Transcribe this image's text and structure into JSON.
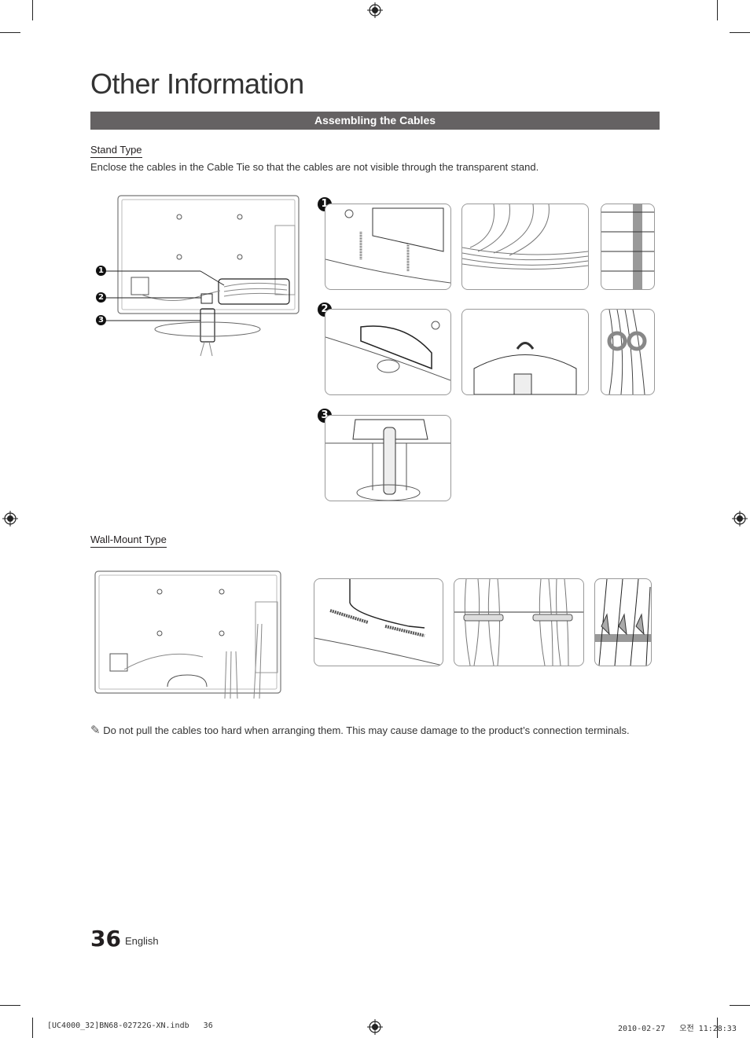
{
  "page": {
    "title": "Other Information",
    "section_title": "Assembling the Cables",
    "stand_type": {
      "heading": "Stand Type",
      "description": "Enclose the cables in the Cable Tie so that the cables are not visible through the transparent stand.",
      "callouts": [
        "1",
        "2",
        "3"
      ]
    },
    "wall_mount_type": {
      "heading": "Wall-Mount Type"
    },
    "note": {
      "icon": "pencil-note-icon",
      "text": "Do not pull the cables too hard when arranging them. This may cause damage to the product’s connection terminals."
    },
    "footer": {
      "page_number": "36",
      "language": "English",
      "slug_left": "[UC4000_32]BN68-02722G-XN.indb   36",
      "slug_right": "2010-02-27   오전 11:28:33"
    }
  }
}
